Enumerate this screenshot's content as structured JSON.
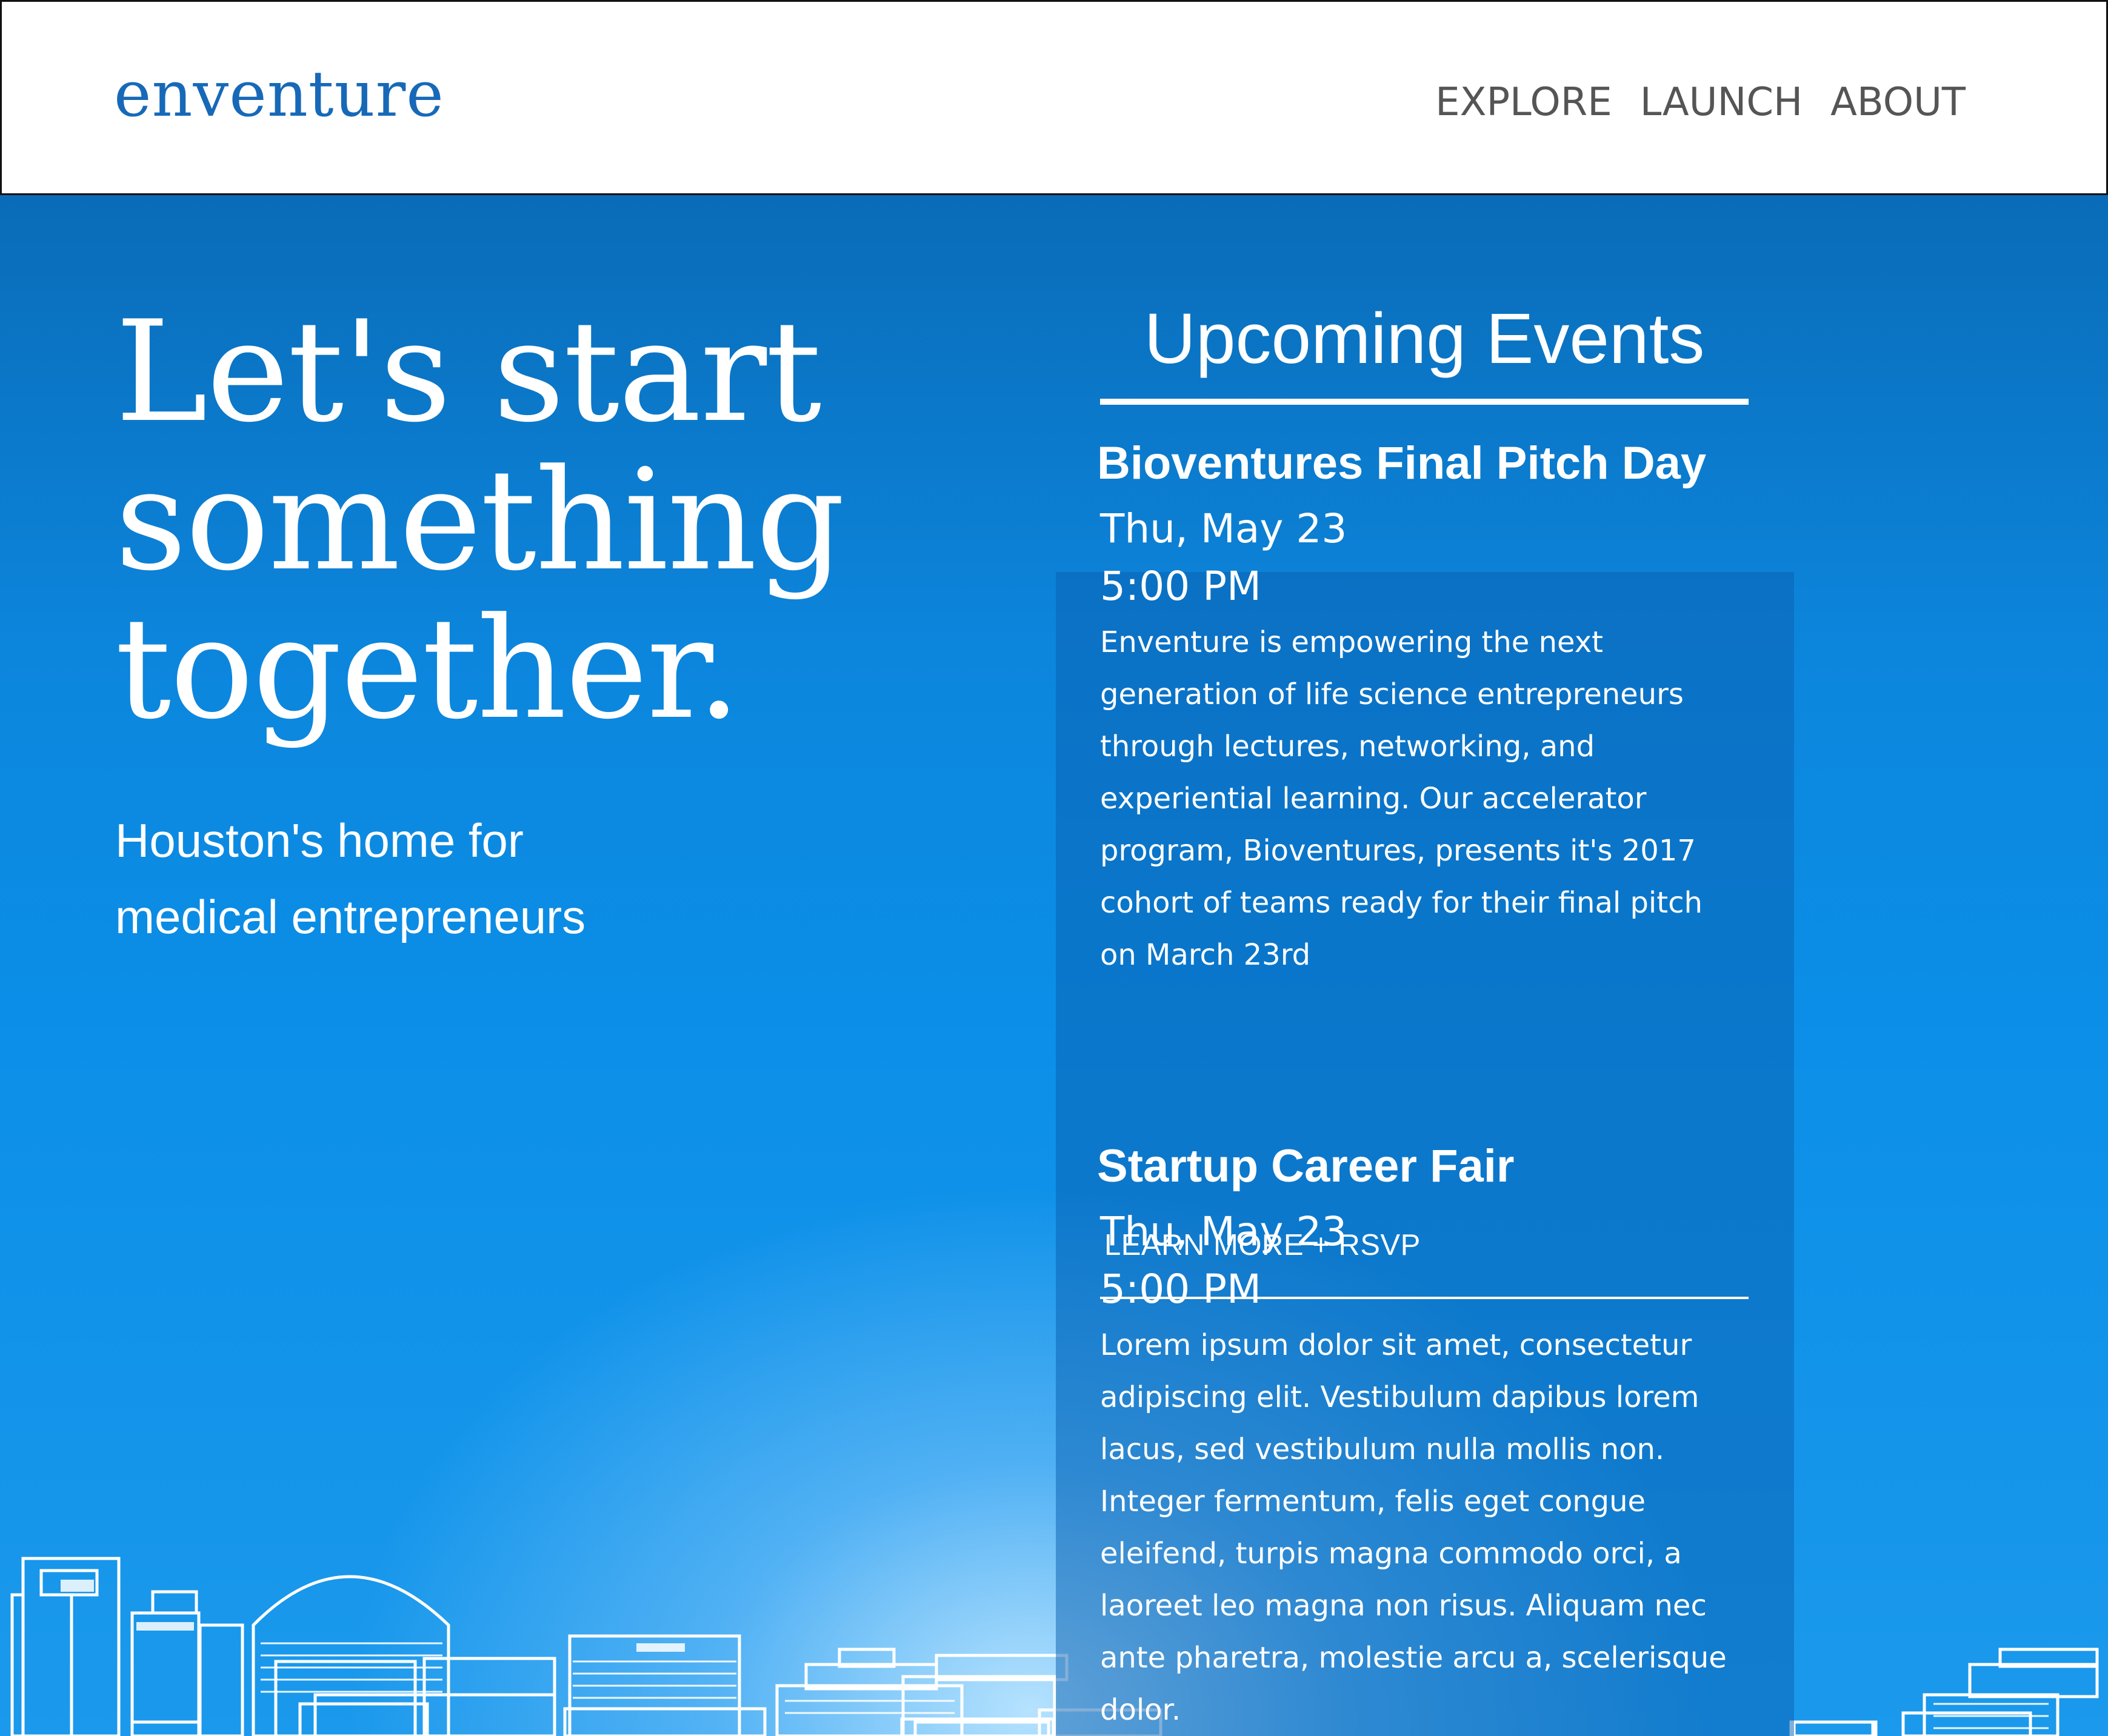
{
  "header": {
    "logo": "enventure",
    "nav": [
      "EXPLORE",
      "LAUNCH",
      "ABOUT"
    ]
  },
  "hero": {
    "title_lines": [
      "Let's start",
      "something",
      "together."
    ],
    "subtitle_lines": [
      "Houston's home for",
      "medical entrepreneurs"
    ]
  },
  "events": {
    "heading": "Upcoming Events",
    "items": [
      {
        "title": "Bioventures Final Pitch Day",
        "date": "Thu, May 23",
        "time": "5:00 PM",
        "description": "Enventure is empowering the next generation of life science entrepreneurs through lectures, networking, and experiential learning. Our accelerator program, Bioventures, presents it's 2017 cohort of teams ready for their final pitch on March 23rd",
        "cta": "LEARN MORE + RSVP"
      },
      {
        "title": "Startup Career Fair",
        "date": "Thu, May 23",
        "time": "5:00 PM",
        "description": "Lorem ipsum dolor sit amet, consectetur adipiscing elit. Vestibulum dapibus lorem lacus, sed vestibulum nulla mollis non. Integer fermentum, felis eget congue eleifend, turpis magna commodo orci, a laoreet leo magna non risus. Aliquam nec ante pharetra, molestie arcu a, scelerisque dolor."
      }
    ]
  },
  "colors": {
    "brand_blue": "#1769b8",
    "hero_blue": "#0b8fe8",
    "nav_text": "#555555"
  },
  "icons": {
    "skyline": "city-skyline-illustration"
  }
}
